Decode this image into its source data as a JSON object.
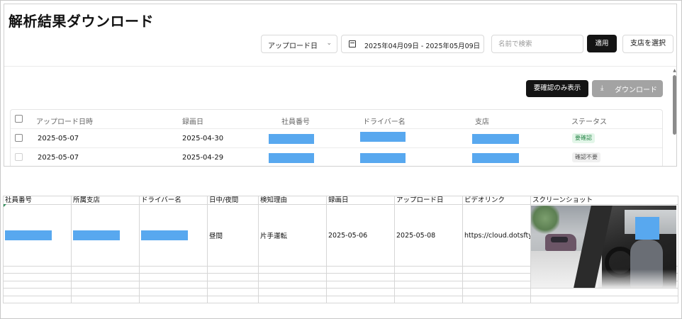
{
  "app": {
    "title": "解析結果ダウンロード",
    "filter_select": {
      "value": "アップロード日",
      "chevron_icon": "chevron-down-icon"
    },
    "date_range": {
      "value": "2025年04月09日 - 2025年05月09日",
      "icon": "calendar-icon"
    },
    "search": {
      "placeholder": "名前で検索"
    },
    "apply_label": "適用",
    "branch_label": "支店を選択",
    "review_only_label": "要確認のみ表示",
    "download_label": "ダウンロード",
    "download_icon": "download-icon",
    "table": {
      "headers": [
        "アップロード日時",
        "録画日",
        "社員番号",
        "ドライバー名",
        "支店",
        "ステータス"
      ],
      "rows": [
        {
          "upload_date": "2025-05-07",
          "record_date": "2025-04-30",
          "status": "要確認",
          "status_color": "#2f8a4e"
        },
        {
          "upload_date": "2025-05-07",
          "record_date": "2025-04-29",
          "status": "確認不要",
          "status_color": "#555555"
        }
      ]
    }
  },
  "sheet": {
    "headers": [
      "社員番号",
      "所属支店",
      "ドライバー名",
      "日中/夜間",
      "検知理由",
      "録画日",
      "アップロード日",
      "ビデオリンク",
      "スクリーンショット"
    ],
    "row": {
      "day_night": "昼間",
      "reason": "片手運転",
      "record_date": "2025-05-06",
      "upload_date": "2025-05-08",
      "video_link": "https://cloud.dotsfty.c"
    }
  },
  "colors": {
    "redaction": "#58a8ef",
    "primary_button": "#141414",
    "disabled_button": "#a3a3a3"
  }
}
